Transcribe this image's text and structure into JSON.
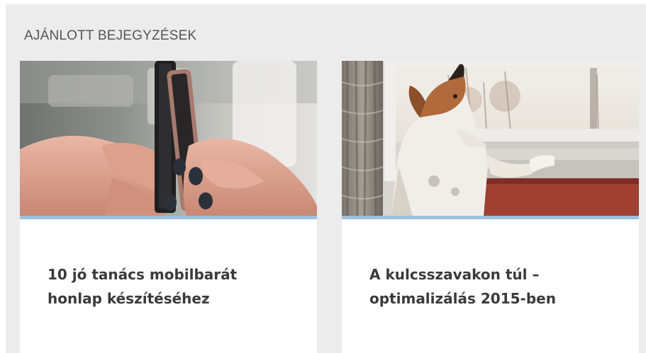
{
  "section": {
    "title": "AJÁNLOTT BEJEGYZÉSEK"
  },
  "colors": {
    "panel_background": "#ececec",
    "card_background": "#ffffff",
    "accent_line": "#9dc1de",
    "title_text": "#3a3a3a",
    "section_text": "#555555"
  },
  "posts": [
    {
      "title": "10 jó tanács mobilbarát honlap készítéséhez",
      "image_subject": "hands-holding-smartphones-image"
    },
    {
      "title": "A kulcsszavakon túl – optimalizálás 2015-ben",
      "image_subject": "dog-looking-out-window-image"
    }
  ]
}
